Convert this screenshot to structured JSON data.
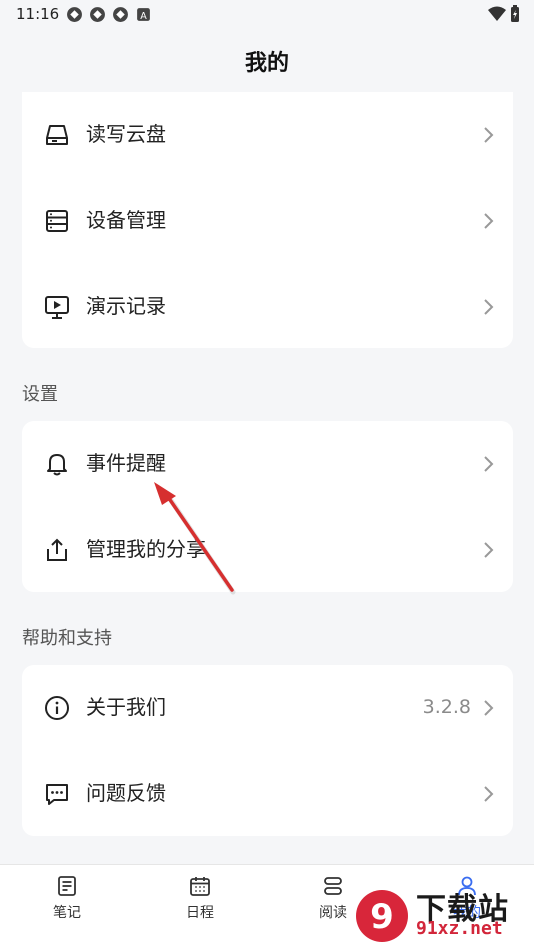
{
  "status_bar": {
    "time": "11:16"
  },
  "header": {
    "title": "我的"
  },
  "group1": {
    "items": [
      {
        "label": "读写云盘",
        "icon": "cloud-drive-icon"
      },
      {
        "label": "设备管理",
        "icon": "device-list-icon"
      },
      {
        "label": "演示记录",
        "icon": "presentation-icon"
      }
    ]
  },
  "settings": {
    "title": "设置",
    "items": [
      {
        "label": "事件提醒",
        "icon": "bell-icon"
      },
      {
        "label": "管理我的分享",
        "icon": "share-icon"
      }
    ]
  },
  "help": {
    "title": "帮助和支持",
    "items": [
      {
        "label": "关于我们",
        "icon": "info-icon",
        "value": "3.2.8"
      },
      {
        "label": "问题反馈",
        "icon": "feedback-icon"
      }
    ]
  },
  "tab_bar": {
    "tabs": [
      {
        "label": "笔记",
        "icon": "notes-icon"
      },
      {
        "label": "日程",
        "icon": "calendar-icon"
      },
      {
        "label": "阅读",
        "icon": "reading-icon"
      },
      {
        "label": "我的",
        "icon": "profile-icon",
        "active": true
      }
    ]
  },
  "watermark": {
    "big": "下载站",
    "small": "91xz.net"
  },
  "colors": {
    "background": "#f5f6f8",
    "card": "#ffffff",
    "accent_arrow": "#d62f2f",
    "active_tab": "#3a6df0"
  }
}
